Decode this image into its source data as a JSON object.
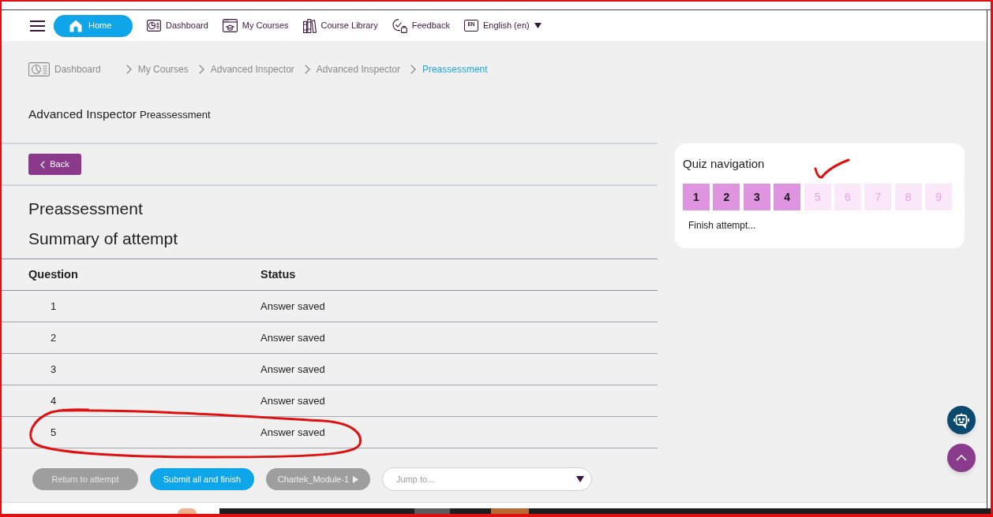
{
  "nav": {
    "items": [
      {
        "kind": "home",
        "label": "Home"
      },
      {
        "kind": "dashboard",
        "label": "Dashboard"
      },
      {
        "kind": "courses",
        "label": "My Courses"
      },
      {
        "kind": "library",
        "label": "Course Library"
      },
      {
        "kind": "feedback",
        "label": "Feedback"
      },
      {
        "kind": "language",
        "label": "English (en)",
        "badge": "EN"
      }
    ]
  },
  "breadcrumb": [
    {
      "label": "Dashboard",
      "selected": false
    },
    {
      "label": "My Courses",
      "selected": false
    },
    {
      "label": "Advanced Inspector",
      "selected": false
    },
    {
      "label": "Advanced Inspector",
      "selected": false
    },
    {
      "label": "Preassessment",
      "selected": true
    }
  ],
  "page_header": {
    "title": "Advanced Inspector",
    "subtitle": "Preassessment"
  },
  "back_button": "Back",
  "heading": "Preassessment",
  "subheading": "Summary of attempt",
  "table": {
    "columns": [
      "Question",
      "Status"
    ],
    "rows": [
      {
        "question": "1",
        "status": "Answer saved"
      },
      {
        "question": "2",
        "status": "Answer saved"
      },
      {
        "question": "3",
        "status": "Answer saved"
      },
      {
        "question": "4",
        "status": "Answer saved"
      },
      {
        "question": "5",
        "status": "Answer saved"
      }
    ]
  },
  "actions": [
    {
      "kind": "secondary",
      "label": "Return to attempt"
    },
    {
      "kind": "primary",
      "label": "Submit all and finish"
    },
    {
      "kind": "next",
      "label": "Chartek_Module-1"
    }
  ],
  "jump_to": {
    "placeholder": "Jump to..."
  },
  "quiz_navigation": {
    "title": "Quiz navigation",
    "questions": [
      {
        "label": "1",
        "answered": true
      },
      {
        "label": "2",
        "answered": true
      },
      {
        "label": "3",
        "answered": true
      },
      {
        "label": "4",
        "answered": true
      },
      {
        "label": "5",
        "answered": false
      },
      {
        "label": "6",
        "answered": false
      },
      {
        "label": "7",
        "answered": false
      },
      {
        "label": "8",
        "answered": false
      },
      {
        "label": "9",
        "answered": false
      }
    ],
    "finish_link": "Finish attempt..."
  },
  "annotations": [
    {
      "kind": "frame"
    },
    {
      "kind": "ellipse"
    },
    {
      "kind": "tick"
    }
  ]
}
